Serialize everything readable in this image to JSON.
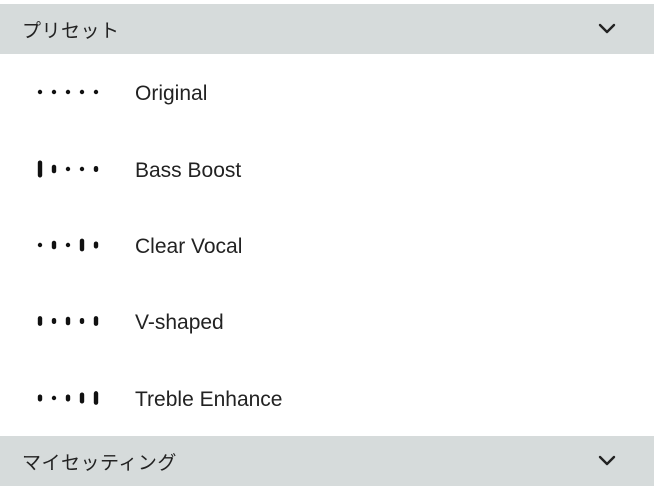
{
  "presets_section": {
    "title": "プリセット",
    "expand_icon": "chevron-down-icon"
  },
  "presets": [
    {
      "label": "Original",
      "icon": "eq-original-icon",
      "bars": [
        0,
        0,
        0,
        0,
        0
      ]
    },
    {
      "label": "Bass Boost",
      "icon": "eq-bass-boost-icon",
      "bars": [
        3,
        1,
        0,
        0,
        0.4
      ]
    },
    {
      "label": "Clear Vocal",
      "icon": "eq-clear-vocal-icon",
      "bars": [
        0,
        1,
        0,
        2,
        0.6
      ]
    },
    {
      "label": "V-shaped",
      "icon": "eq-v-shaped-icon",
      "bars": [
        1.3,
        0.4,
        1,
        0.4,
        1.3
      ]
    },
    {
      "label": "Treble Enhance",
      "icon": "eq-treble-enhance-icon",
      "bars": [
        0.6,
        0,
        0.6,
        1.6,
        2.2
      ]
    }
  ],
  "my_settings_section": {
    "title": "マイセッティング",
    "expand_icon": "chevron-down-icon"
  }
}
